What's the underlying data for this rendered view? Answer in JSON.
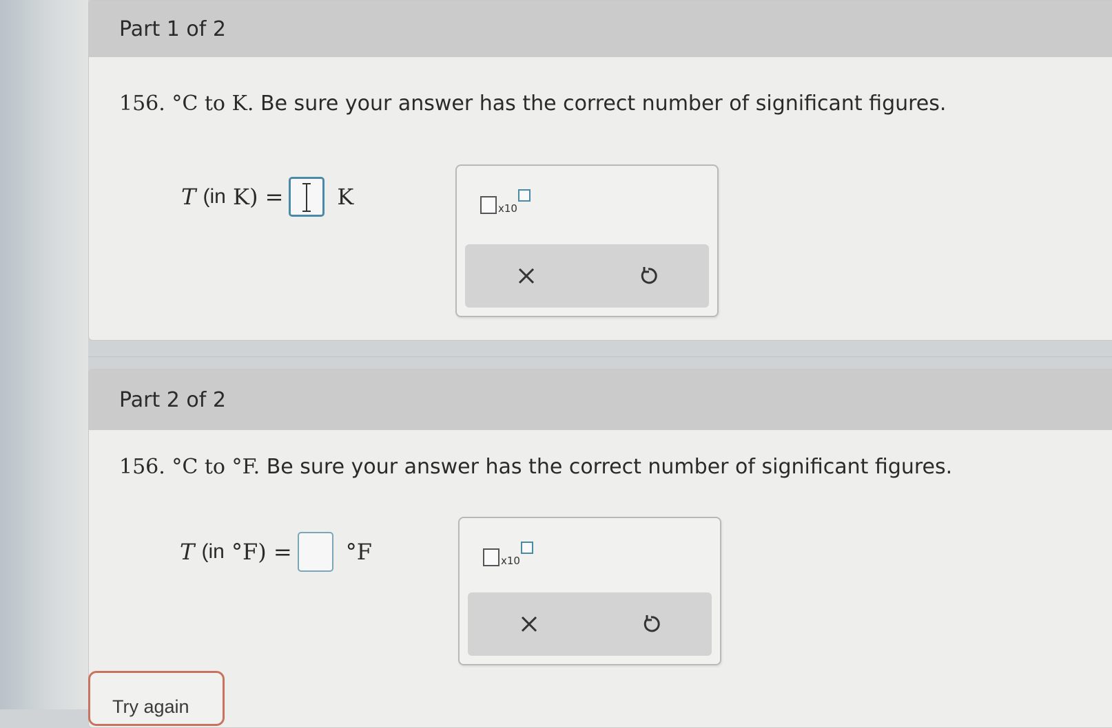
{
  "part1": {
    "header": "Part 1 of 2",
    "question_num": "156.",
    "question_unit_text": "°C to K.",
    "question_text": "Be sure your answer has the correct number of significant figures.",
    "eq_var": "T",
    "eq_open": "(in",
    "eq_unit_in": "K)",
    "eq_equals": "=",
    "eq_unit": "K",
    "toolbox": {
      "x10_label": "x10"
    }
  },
  "part2": {
    "header": "Part 2 of 2",
    "question_num": "156.",
    "question_unit_text": "°C to °F.",
    "question_text": "Be sure your answer has the correct number of significant figures.",
    "eq_var": "T",
    "eq_open": "(in",
    "eq_unit_in": "°F)",
    "eq_equals": "=",
    "eq_unit": "°F",
    "toolbox": {
      "x10_label": "x10"
    }
  },
  "try_again_label": "Try again",
  "icons": {
    "clear": "close-icon",
    "undo": "undo-icon"
  },
  "colors": {
    "accent": "#4b8aa6",
    "try_border": "#c8735f",
    "header_bg": "#cbcbcb"
  }
}
